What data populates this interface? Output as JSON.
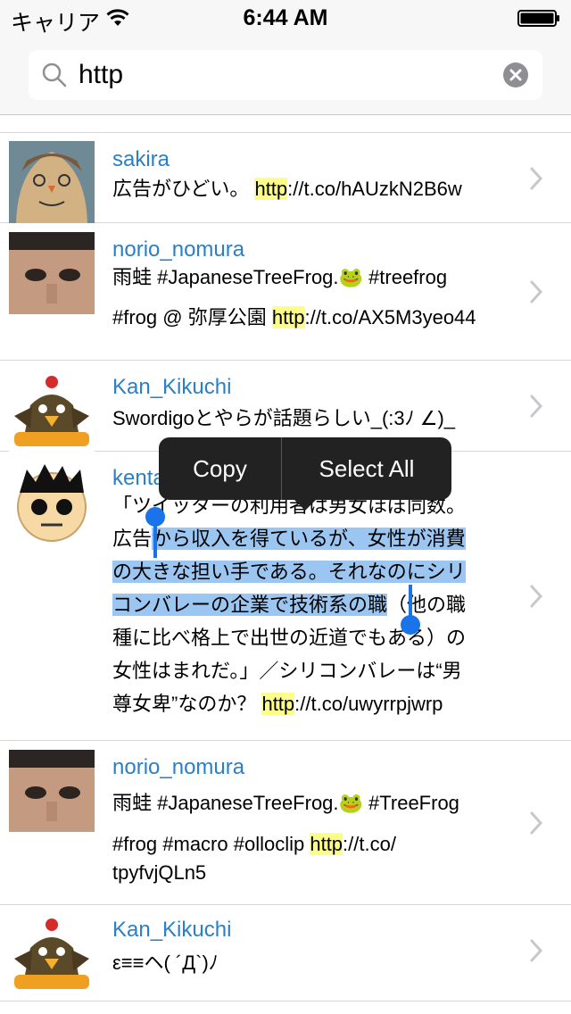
{
  "status": {
    "carrier": "キャリア",
    "time": "6:44 AM"
  },
  "search": {
    "value": "http",
    "placeholder": ""
  },
  "menu": {
    "copy": "Copy",
    "select_all": "Select All"
  },
  "rows": [
    {
      "user": "sakira",
      "lines": [
        [
          "広告がひどい。 ",
          "http",
          "://t.co/hAUzkN2B6w"
        ]
      ]
    },
    {
      "user": "norio_nomura",
      "lines": [
        [
          "雨蛙 #JapaneseTreeFrog.🐸 #treefrog"
        ],
        [
          "#frog @ 弥厚公園 ",
          "http",
          "://t.co/AX5M3yeo44"
        ]
      ]
    },
    {
      "user": "Kan_Kikuchi",
      "lines": [
        [
          "Swordigoとやらが話題らしい_(:3ﾉ ∠)_"
        ]
      ]
    },
    {
      "user": "kenta",
      "l1": "「ツイッターの利用者は男女ほぼ同数。",
      "l2a": "広告",
      "l2b": "から収入を得ているが、女性が消費",
      "l3": "の大きな担い手である。それなのにシリ",
      "l4a": "コンバレーの企業で技術系の職",
      "l4b": "（他の職",
      "l5": "種に比べ格上で出世の近道でもある）の",
      "l6": "女性はまれだ。」／シリコンバレーは“男",
      "l7a": "尊女卑”なのか？ ",
      "l7b": "http",
      "l7c": "://t.co/uwyrrpjwrp"
    },
    {
      "user": "norio_nomura",
      "lines": [
        [
          "雨蛙 #JapaneseTreeFrog.🐸 #TreeFrog"
        ],
        [
          "#frog #macro #olloclip ",
          "http",
          "://t.co/"
        ],
        [
          "tpyfvjQLn5"
        ]
      ]
    },
    {
      "user": "Kan_Kikuchi",
      "lines": [
        [
          "ε≡≡ヘ( ´Д`)ﾉ"
        ]
      ]
    }
  ],
  "colors": {
    "link": "#2a7fc5",
    "highlight": "#fdfd8a",
    "selection": "#9cc6f2",
    "menu": "#222222"
  }
}
